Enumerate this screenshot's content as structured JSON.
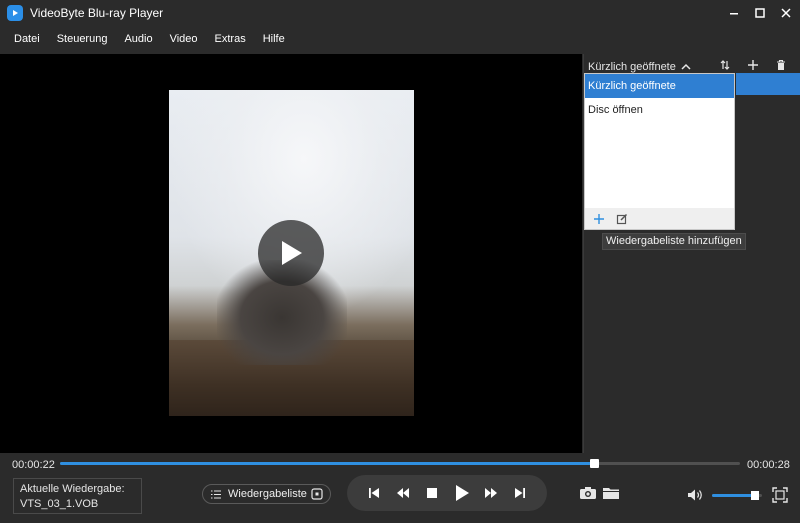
{
  "window": {
    "title": "VideoByte Blu-ray Player"
  },
  "menu": {
    "items": [
      "Datei",
      "Steuerung",
      "Audio",
      "Video",
      "Extras",
      "Hilfe"
    ]
  },
  "panel": {
    "title": "Kürzlich geöffnete",
    "dropdown_items": [
      "Kürzlich geöffnete",
      "Disc öffnen"
    ],
    "tooltip": "Wiedergabeliste hinzufügen"
  },
  "playback": {
    "current_time": "00:00:22",
    "total_time": "00:00:28",
    "progress": 0.786,
    "volume": 0.85
  },
  "now_playing": {
    "label": "Aktuelle Wiedergabe:",
    "file": "VTS_03_1.VOB"
  },
  "playlist_button": {
    "label": "Wiedergabeliste"
  },
  "colors": {
    "accent": "#2f8fe0",
    "selection": "#2f7fd2",
    "background": "#2b2b2b"
  }
}
